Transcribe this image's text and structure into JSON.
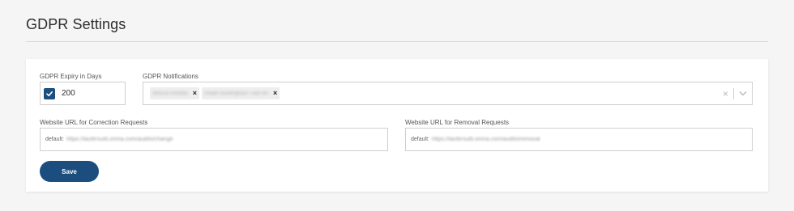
{
  "page": {
    "title": "GDPR Settings"
  },
  "expiry": {
    "label": "GDPR Expiry in Days",
    "value": "200",
    "checked": true
  },
  "notifications": {
    "label": "GDPR Notifications",
    "tags": [
      {
        "text": "Melissa Rondilla"
      },
      {
        "text": "Shawn Buckinghash Tuaz-ion"
      }
    ]
  },
  "correction_url": {
    "label": "Website URL for Correction Requests",
    "prefix": "default:",
    "value": "https://laufersutti.orima.com/audits/change"
  },
  "removal_url": {
    "label": "Website URL for Removal Requests",
    "prefix": "default:",
    "value": "https://laufersutti.orima.com/audits/removal"
  },
  "actions": {
    "save_label": "Save"
  },
  "colors": {
    "accent": "#1b4e7e",
    "checkbox": "#1a4f80"
  }
}
